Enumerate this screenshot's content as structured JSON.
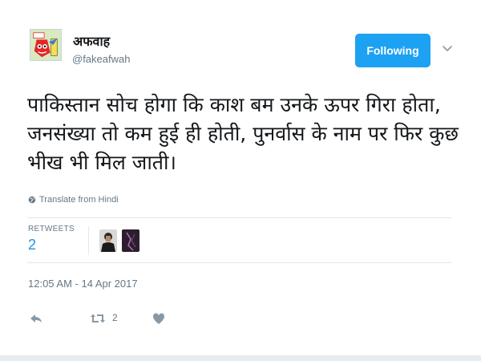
{
  "tweet": {
    "author_name": "अफवाह",
    "author_handle": "@fakeafwah",
    "follow_label": "Following",
    "text": "पाकिस्तान सोच होगा कि काश बम उनके ऊपर गिरा होता, जनसंख्या तो कम हुई ही होती, पुनर्वास के नाम पर फिर कुछ भीख भी मिल जाती।",
    "translate_label": "Translate from Hindi",
    "retweets_label": "RETWEETS",
    "retweets_count": "2",
    "timestamp": "12:05 AM - 14 Apr 2017",
    "retweet_action_count": "2"
  },
  "icons": {
    "avatar": "afwah-logo",
    "menu": "chevron-down-icon",
    "translate": "globe-icon",
    "reply": "reply-icon",
    "retweet": "retweet-icon",
    "like": "heart-icon"
  },
  "colors": {
    "accent": "#1da1f2",
    "link": "#1b95e0",
    "muted": "#657786",
    "text": "#14171a"
  }
}
